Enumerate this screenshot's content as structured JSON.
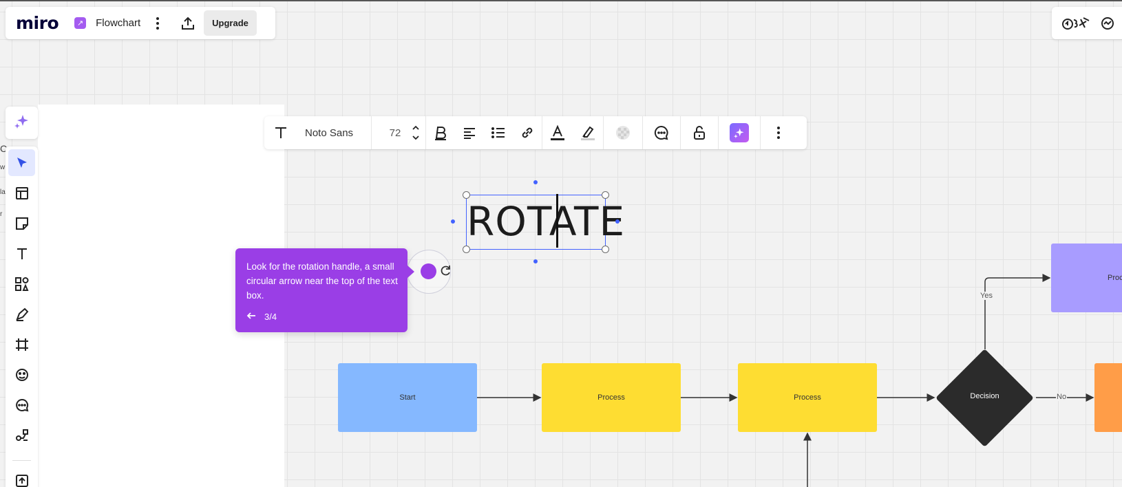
{
  "topbar": {
    "logo": "miro",
    "board_name": "Flowchart",
    "upgrade_label": "Upgrade"
  },
  "format_toolbar": {
    "font_name": "Noto Sans",
    "font_size": "72"
  },
  "canvas": {
    "text_element": "ROTATE"
  },
  "tooltip": {
    "text": "Look for the rotation handle, a small circular arrow near the top of the text box.",
    "step": "3/4"
  },
  "flowchart": {
    "start": "Start",
    "process1": "Process",
    "process2": "Process",
    "process_top": "Proc",
    "decision": "Decision",
    "yes_label": "Yes",
    "no_label": "No"
  },
  "colors": {
    "accent_purple": "#9a3ee6",
    "selection_blue": "#4262ff",
    "start_blue": "#85b8ff",
    "process_yellow": "#fedd32",
    "top_purple": "#a89cff",
    "decision_dark": "#2b2b2b",
    "orange": "#ff9d48"
  },
  "icons": {
    "left_toolbar": [
      "ai-sparkle-icon",
      "select-cursor-icon",
      "templates-icon",
      "sticky-note-icon",
      "text-icon",
      "shapes-icon",
      "pen-icon",
      "frame-icon",
      "stickers-icon",
      "comment-icon",
      "diagram-icon",
      "upload-icon"
    ],
    "format_toolbar": [
      "text-type-icon",
      "font-size-stepper",
      "bold-icon",
      "align-left-icon",
      "bullet-list-icon",
      "link-icon",
      "text-color-icon",
      "highlight-icon",
      "fill-transparent-icon",
      "comment-icon",
      "unlock-icon",
      "ai-sparkle-icon",
      "more-vertical-icon"
    ]
  }
}
